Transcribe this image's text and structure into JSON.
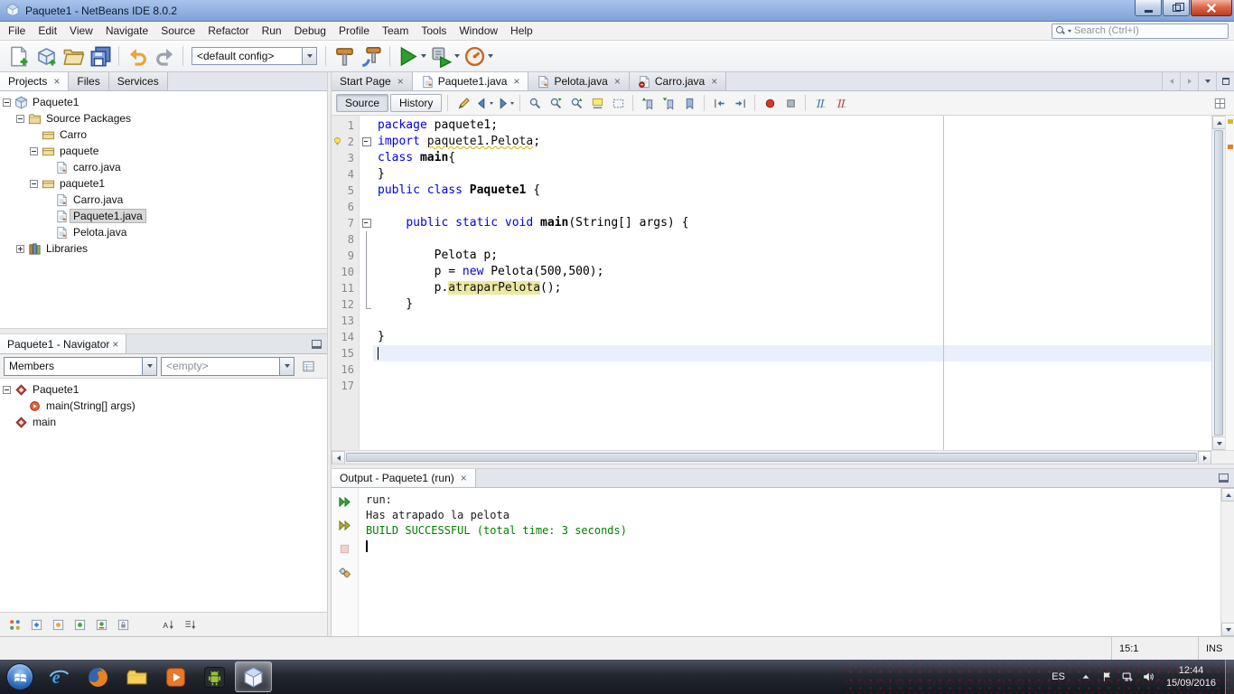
{
  "window": {
    "title": "Paquete1 - NetBeans IDE 8.0.2"
  },
  "menubar": {
    "items": [
      "File",
      "Edit",
      "View",
      "Navigate",
      "Source",
      "Refactor",
      "Run",
      "Debug",
      "Profile",
      "Team",
      "Tools",
      "Window",
      "Help"
    ],
    "search_placeholder": "Search (Ctrl+I)"
  },
  "toolbar": {
    "config_value": "<default config>",
    "groups": [
      [
        {
          "name": "new-file"
        },
        {
          "name": "new-project"
        },
        {
          "name": "open-project"
        },
        {
          "name": "save-all"
        }
      ],
      [
        {
          "name": "undo"
        },
        {
          "name": "redo"
        }
      ],
      [
        {
          "name": "build-project"
        },
        {
          "name": "clean-build-project"
        }
      ],
      [
        {
          "name": "run-project",
          "dropdown": true
        },
        {
          "name": "debug-project",
          "dropdown": true
        },
        {
          "name": "profile-project",
          "dropdown": true
        }
      ]
    ]
  },
  "projects_panel": {
    "tabs": [
      {
        "label": "Projects",
        "active": true,
        "closable": true
      },
      {
        "label": "Files",
        "active": false,
        "closable": false
      },
      {
        "label": "Services",
        "active": false,
        "closable": false
      }
    ],
    "tree": [
      {
        "label": "Paquete1",
        "icon": "project",
        "level": 0,
        "expander": "minus"
      },
      {
        "label": "Source Packages",
        "icon": "source-root",
        "level": 1,
        "expander": "minus"
      },
      {
        "label": "Carro",
        "icon": "package",
        "level": 2,
        "expander": "none"
      },
      {
        "label": "paquete",
        "icon": "package",
        "level": 2,
        "expander": "minus"
      },
      {
        "label": "carro.java",
        "icon": "java-file",
        "level": 3,
        "expander": "none"
      },
      {
        "label": "paquete1",
        "icon": "package",
        "level": 2,
        "expander": "minus"
      },
      {
        "label": "Carro.java",
        "icon": "java-file",
        "level": 3,
        "expander": "none"
      },
      {
        "label": "Paquete1.java",
        "icon": "java-file",
        "level": 3,
        "expander": "none",
        "selected": true
      },
      {
        "label": "Pelota.java",
        "icon": "java-file",
        "level": 3,
        "expander": "none"
      },
      {
        "label": "Libraries",
        "icon": "libraries",
        "level": 1,
        "expander": "plus"
      }
    ]
  },
  "navigator": {
    "title": "Paquete1 - Navigator",
    "members_filter": "Members",
    "name_filter": "<empty>",
    "tree": [
      {
        "label": "Paquete1",
        "icon": "class",
        "level": 0,
        "expander": "minus"
      },
      {
        "label": "main(String[] args)",
        "icon": "method",
        "level": 1,
        "expander": "none"
      },
      {
        "label": "main",
        "icon": "class",
        "level": 0,
        "expander": "none"
      }
    ],
    "toolbar": [
      {
        "name": "show-inherited"
      },
      {
        "name": "show-fields"
      },
      {
        "name": "show-constructors"
      },
      {
        "name": "show-methods"
      },
      {
        "name": "show-static"
      },
      {
        "name": "show-non-public"
      },
      {
        "name": "sort-by-name",
        "gap": true
      },
      {
        "name": "sort-by-source"
      }
    ]
  },
  "editor": {
    "tabs": [
      {
        "label": "Start Page",
        "icon": "none",
        "active": false
      },
      {
        "label": "Paquete1.java",
        "icon": "java",
        "active": true
      },
      {
        "label": "Pelota.java",
        "icon": "java",
        "active": false
      },
      {
        "label": "Carro.java",
        "icon": "java-error",
        "active": false
      }
    ],
    "toolbar": {
      "source_label": "Source",
      "history_label": "History",
      "buttons": [
        {
          "name": "last-edited"
        },
        {
          "name": "back",
          "dropdown": true
        },
        {
          "name": "forward",
          "dropdown": true
        },
        {
          "separator": true
        },
        {
          "name": "find-selection"
        },
        {
          "name": "find-next-occurrence"
        },
        {
          "name": "find-previous-occurrence"
        },
        {
          "name": "toggle-highlight-search"
        },
        {
          "name": "toggle-rectangular-selection"
        },
        {
          "separator": true
        },
        {
          "name": "previous-bookmark"
        },
        {
          "name": "next-bookmark"
        },
        {
          "name": "toggle-bookmark"
        },
        {
          "separator": true
        },
        {
          "name": "shift-line-left"
        },
        {
          "name": "shift-line-right"
        },
        {
          "separator": true
        },
        {
          "name": "start-macro-recording"
        },
        {
          "name": "stop-macro-recording"
        },
        {
          "separator": true
        },
        {
          "name": "comment"
        },
        {
          "name": "uncomment"
        }
      ]
    },
    "code_lines": [
      {
        "n": 1,
        "fold": "",
        "segs": [
          {
            "t": "package",
            "c": "kw"
          },
          {
            "t": " paquete1;",
            "c": "p"
          }
        ]
      },
      {
        "n": 2,
        "fold": "minus",
        "glyph": "warning",
        "segs": [
          {
            "t": "import",
            "c": "kw"
          },
          {
            "t": " ",
            "c": "p"
          },
          {
            "t": "paquete1.Pelota",
            "c": "warn"
          },
          {
            "t": ";",
            "c": "p"
          }
        ]
      },
      {
        "n": 3,
        "fold": "",
        "segs": [
          {
            "t": "class",
            "c": "kw"
          },
          {
            "t": " ",
            "c": "p"
          },
          {
            "t": "main",
            "c": "b"
          },
          {
            "t": "{",
            "c": "p"
          }
        ]
      },
      {
        "n": 4,
        "fold": "",
        "segs": [
          {
            "t": "}",
            "c": "p"
          }
        ]
      },
      {
        "n": 5,
        "fold": "",
        "segs": [
          {
            "t": "public",
            "c": "kw"
          },
          {
            "t": " ",
            "c": "p"
          },
          {
            "t": "class",
            "c": "kw"
          },
          {
            "t": " ",
            "c": "p"
          },
          {
            "t": "Paquete1",
            "c": "b"
          },
          {
            "t": " {",
            "c": "p"
          }
        ]
      },
      {
        "n": 6,
        "fold": "",
        "segs": []
      },
      {
        "n": 7,
        "fold": "minus",
        "segs": [
          {
            "t": "    ",
            "c": "p"
          },
          {
            "t": "public",
            "c": "kw"
          },
          {
            "t": " ",
            "c": "p"
          },
          {
            "t": "static",
            "c": "kw"
          },
          {
            "t": " ",
            "c": "p"
          },
          {
            "t": "void",
            "c": "kw"
          },
          {
            "t": " ",
            "c": "p"
          },
          {
            "t": "main",
            "c": "b"
          },
          {
            "t": "(String[] args) {",
            "c": "p"
          }
        ]
      },
      {
        "n": 8,
        "fold": "vline",
        "segs": []
      },
      {
        "n": 9,
        "fold": "vline",
        "segs": [
          {
            "t": "        Pelota p;",
            "c": "p"
          }
        ]
      },
      {
        "n": 10,
        "fold": "vline",
        "segs": [
          {
            "t": "        p = ",
            "c": "p"
          },
          {
            "t": "new",
            "c": "kw"
          },
          {
            "t": " Pelota(500,500);",
            "c": "p"
          }
        ]
      },
      {
        "n": 11,
        "fold": "vline",
        "segs": [
          {
            "t": "        p.",
            "c": "p"
          },
          {
            "t": "atraparPelota",
            "c": "hl"
          },
          {
            "t": "();",
            "c": "p"
          }
        ]
      },
      {
        "n": 12,
        "fold": "end",
        "segs": [
          {
            "t": "    }",
            "c": "p"
          }
        ]
      },
      {
        "n": 13,
        "fold": "",
        "segs": []
      },
      {
        "n": 14,
        "fold": "",
        "segs": [
          {
            "t": "}",
            "c": "p"
          }
        ]
      },
      {
        "n": 15,
        "fold": "",
        "caret": true,
        "segs": []
      },
      {
        "n": 16,
        "fold": "",
        "segs": []
      },
      {
        "n": 17,
        "fold": "",
        "segs": []
      }
    ]
  },
  "output": {
    "tab_title": "Output - Paquete1 (run)",
    "buttons": [
      {
        "name": "rerun"
      },
      {
        "name": "rerun-debug"
      },
      {
        "name": "stop",
        "disabled": true
      },
      {
        "name": "ant-settings"
      }
    ],
    "lines": [
      {
        "text": "run:",
        "style": "plain"
      },
      {
        "text": "Has atrapado la pelota",
        "style": "plain"
      },
      {
        "text": "BUILD SUCCESSFUL (total time: 3 seconds)",
        "style": "success"
      }
    ]
  },
  "statusbar": {
    "caret_position": "15:1",
    "insert_mode": "INS"
  },
  "taskbar": {
    "language": "ES",
    "time": "12:44",
    "date": "15/09/2016",
    "apps": [
      {
        "name": "internet-explorer"
      },
      {
        "name": "firefox"
      },
      {
        "name": "windows-explorer"
      },
      {
        "name": "media-player"
      },
      {
        "name": "android"
      },
      {
        "name": "netbeans",
        "active": true
      }
    ],
    "tray_icons": [
      {
        "name": "hidden-icons"
      },
      {
        "name": "action-center"
      },
      {
        "name": "network"
      },
      {
        "name": "volume"
      }
    ]
  },
  "colors": {
    "keyword": "#0000e6",
    "occurrence": "#ece99f",
    "caret-line": "#e9effb",
    "margin": "#f0b0b0",
    "success": "#008000",
    "warning": "#c8b400",
    "titlebar-top": "#a9c3ec",
    "titlebar-bottom": "#7fa3d8",
    "selection": "#d8d8d8",
    "taskbar-top": "#4a5160",
    "taskbar-bottom": "#15181f"
  }
}
